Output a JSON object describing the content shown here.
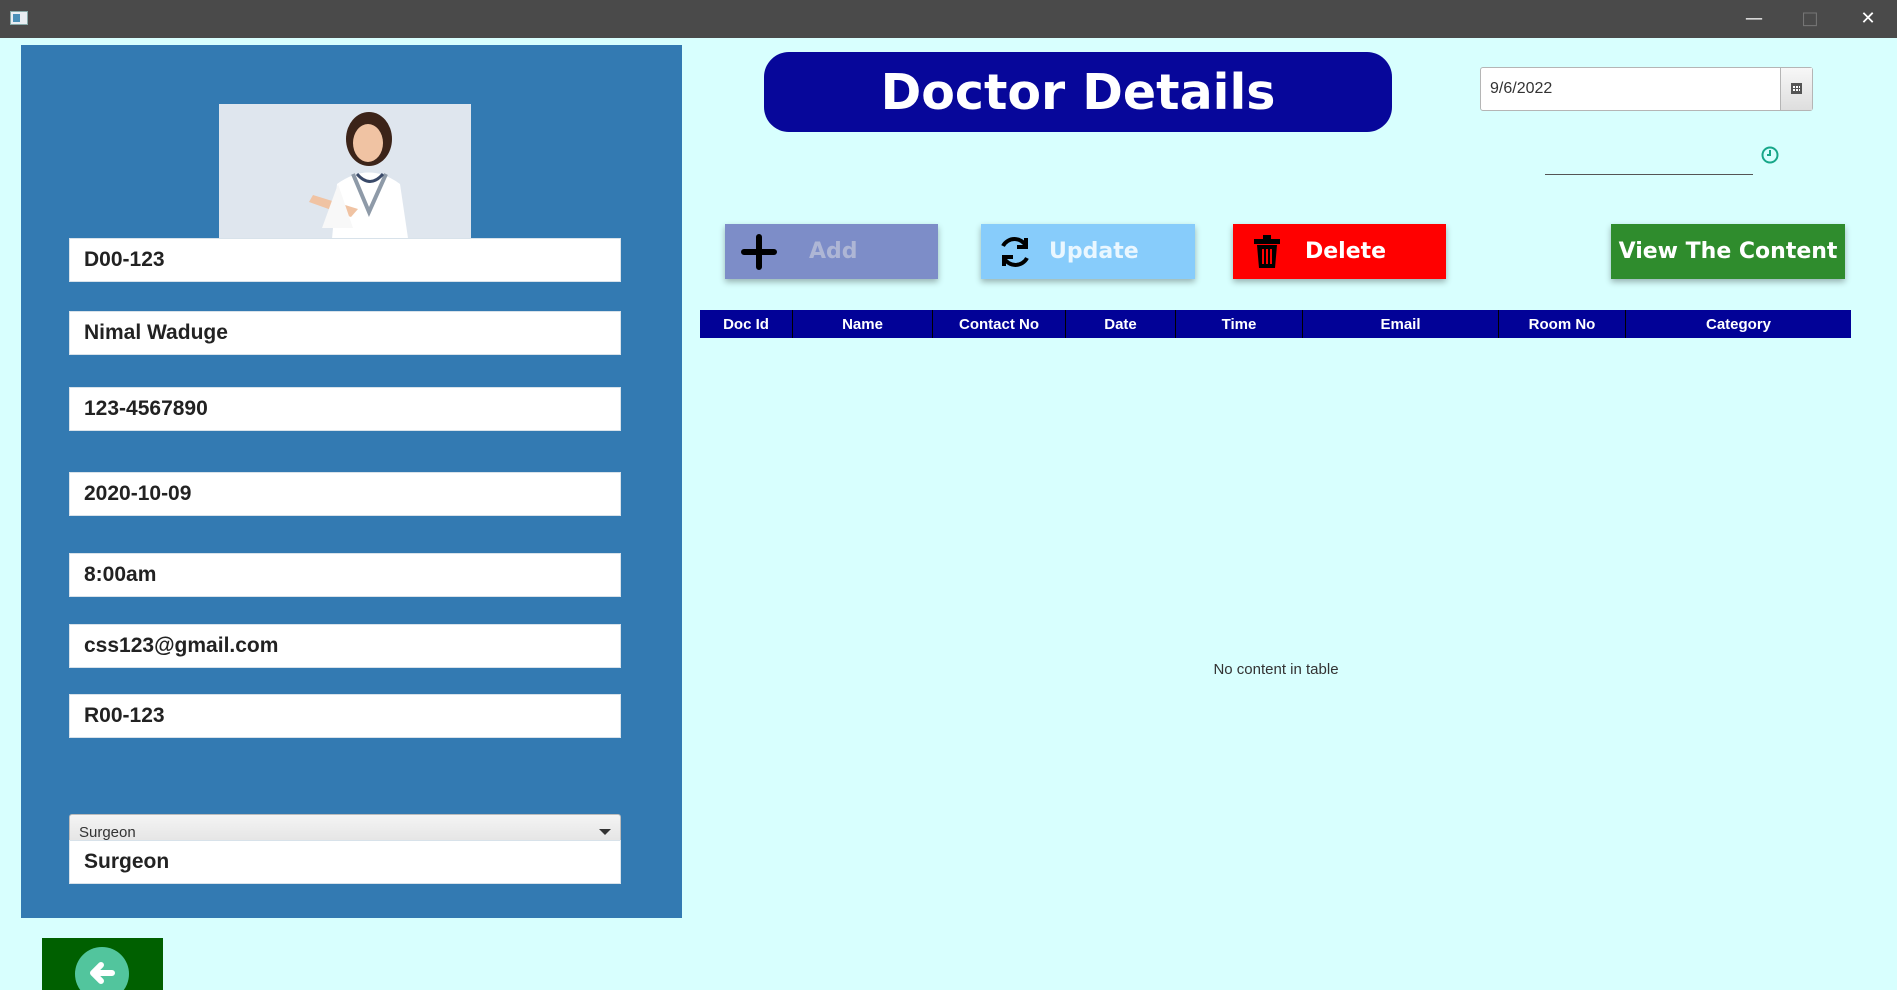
{
  "window": {
    "minimize_glyph": "—",
    "maximize_glyph": "□",
    "close_glyph": "✕"
  },
  "form": {
    "doctor_id": "D00-123",
    "name": "Nimal Waduge",
    "contact_no": "123-4567890",
    "date": "2020-10-09",
    "time": "8:00am",
    "email": "css123@gmail.com",
    "room_no": "R00-123",
    "category_select": "Surgeon",
    "category": "Surgeon"
  },
  "heading": "Doctor Details",
  "date_picker": {
    "value": "9/6/2022"
  },
  "buttons": {
    "add": "Add",
    "update": "Update",
    "delete": "Delete",
    "view": "View The Content"
  },
  "table": {
    "columns": [
      "Doc Id",
      "Name",
      "Contact No",
      "Date",
      "Time",
      "Email",
      "Room No",
      "Category"
    ],
    "empty_message": "No content in table"
  },
  "colors": {
    "background": "#d8fffe",
    "left_panel": "#337ab2",
    "heading": "#07079a",
    "table_header": "#020297",
    "add": "#7d8dc8",
    "update": "#87ccfb",
    "delete": "#ff0000",
    "view": "#2f8c2d",
    "back_button": "#006000"
  },
  "icons": {
    "add": "plus-icon",
    "update": "refresh-icon",
    "delete": "trash-icon",
    "date": "calendar-icon",
    "time": "clock-icon",
    "back": "arrow-left-icon"
  }
}
